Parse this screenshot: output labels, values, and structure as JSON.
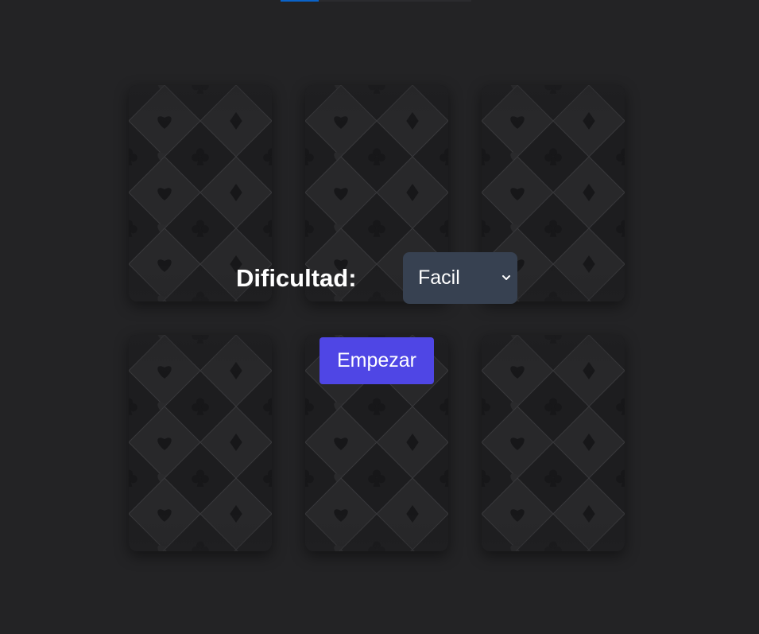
{
  "progress": {
    "fraction": 0.2
  },
  "cards": [
    {
      "face": "card-back-pattern"
    },
    {
      "face": "card-back-pattern"
    },
    {
      "face": "card-back-pattern"
    },
    {
      "face": "card-back-pattern"
    },
    {
      "face": "card-back-pattern"
    },
    {
      "face": "card-back-pattern"
    }
  ],
  "difficulty": {
    "label": "Dificultad:",
    "selected": "Facil",
    "icon": "chevron-down-icon"
  },
  "start_button": {
    "label": "Empezar"
  },
  "colors": {
    "background": "#232325",
    "select_bg": "#374151",
    "button_bg": "#4f46e5",
    "progress_fill": "#0a63c9"
  }
}
